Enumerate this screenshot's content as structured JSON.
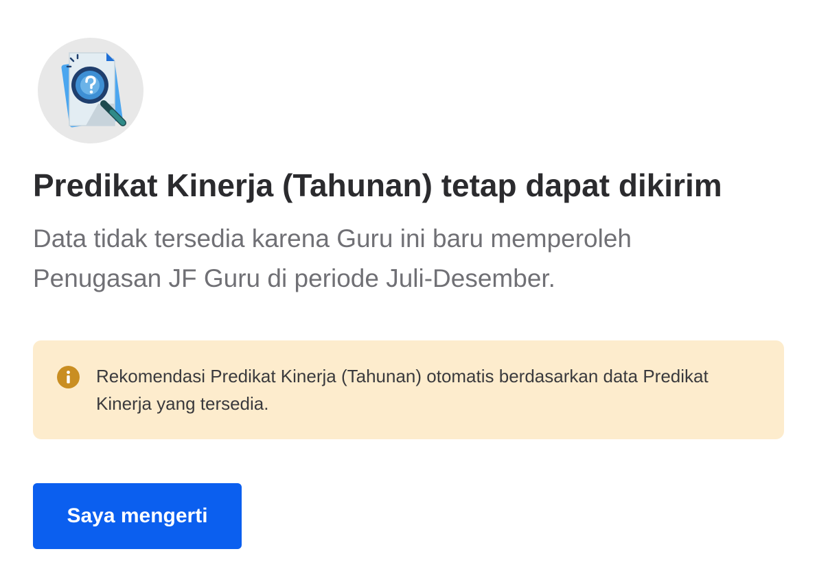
{
  "illustration": {
    "icon": "document-search-icon"
  },
  "title": "Predikat Kinerja (Tahunan) tetap dapat dikirim",
  "subtitle": "Data tidak tersedia karena Guru ini baru memperoleh Penugasan JF Guru di periode Juli-Desember.",
  "info": {
    "icon": "info-icon",
    "text": "Rekomendasi Predikat Kinerja (Tahunan) otomatis berdasarkan data Predikat Kinerja yang tersedia."
  },
  "button": {
    "label": "Saya mengerti"
  },
  "colors": {
    "primary": "#0b5fef",
    "info_background": "#fdeccd",
    "info_icon": "#c98e22",
    "title": "#2b2b2e",
    "subtitle": "#707075"
  }
}
